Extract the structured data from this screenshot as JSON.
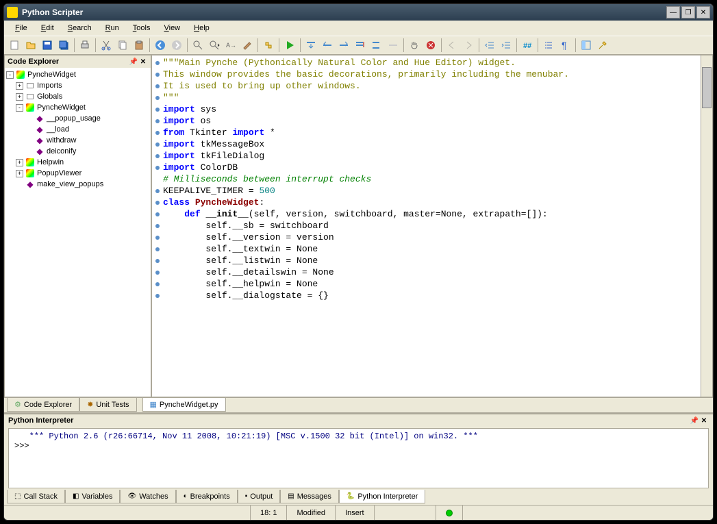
{
  "window": {
    "title": "Python Scripter"
  },
  "menu": [
    "File",
    "Edit",
    "Search",
    "Run",
    "Tools",
    "View",
    "Help"
  ],
  "explorer": {
    "title": "Code Explorer",
    "nodes": [
      {
        "indent": 0,
        "toggle": "-",
        "icon": "module",
        "label": "PyncheWidget"
      },
      {
        "indent": 1,
        "toggle": "+",
        "icon": "folder",
        "label": "Imports"
      },
      {
        "indent": 1,
        "toggle": "+",
        "icon": "folder",
        "label": "Globals"
      },
      {
        "indent": 1,
        "toggle": "-",
        "icon": "module",
        "label": "PyncheWidget"
      },
      {
        "indent": 2,
        "toggle": "",
        "icon": "method",
        "label": "__popup_usage"
      },
      {
        "indent": 2,
        "toggle": "",
        "icon": "method",
        "label": "__load"
      },
      {
        "indent": 2,
        "toggle": "",
        "icon": "method",
        "label": "withdraw"
      },
      {
        "indent": 2,
        "toggle": "",
        "icon": "method",
        "label": "deiconify"
      },
      {
        "indent": 1,
        "toggle": "+",
        "icon": "module",
        "label": "Helpwin"
      },
      {
        "indent": 1,
        "toggle": "+",
        "icon": "module",
        "label": "PopupViewer"
      },
      {
        "indent": 1,
        "toggle": "",
        "icon": "method",
        "label": "make_view_popups"
      }
    ]
  },
  "code": {
    "lines": [
      {
        "m": 1,
        "html": "<span class='str'>\"\"\"Main Pynche (Pythonically Natural Color and Hue Editor) widget.</span>"
      },
      {
        "m": 0,
        "html": ""
      },
      {
        "m": 1,
        "html": "<span class='str'>This window provides the basic decorations, primarily including the menubar.</span>"
      },
      {
        "m": 1,
        "html": "<span class='str'>It is used to bring up other windows.</span>"
      },
      {
        "m": 1,
        "html": "<span class='str'>\"\"\"</span>"
      },
      {
        "m": 0,
        "html": ""
      },
      {
        "m": 1,
        "html": "<span class='kw'>import</span> sys"
      },
      {
        "m": 1,
        "html": "<span class='kw'>import</span> os"
      },
      {
        "m": 1,
        "html": "<span class='kw'>from</span> Tkinter <span class='kw'>import</span> *"
      },
      {
        "m": 1,
        "html": "<span class='kw'>import</span> tkMessageBox"
      },
      {
        "m": 1,
        "html": "<span class='kw'>import</span> tkFileDialog"
      },
      {
        "m": 1,
        "html": "<span class='kw'>import</span> ColorDB"
      },
      {
        "m": 0,
        "html": ""
      },
      {
        "m": 0,
        "html": "<span class='com'># Milliseconds between interrupt checks</span>"
      },
      {
        "m": 1,
        "html": "KEEPALIVE_TIMER = <span class='num'>500</span>"
      },
      {
        "m": 0,
        "html": ""
      },
      {
        "m": 0,
        "html": ""
      },
      {
        "m": 0,
        "html": ""
      },
      {
        "m": 1,
        "html": "<span class='cls'>class</span> <span class='clsname'>PyncheWidget</span>:"
      },
      {
        "m": 1,
        "html": "    <span class='kw'>def</span> <span class='fn'>__init__</span>(self, version, switchboard, master=None, extrapath=[]):"
      },
      {
        "m": 1,
        "html": "        self.__sb = switchboard"
      },
      {
        "m": 1,
        "html": "        self.__version = version"
      },
      {
        "m": 1,
        "html": "        self.__textwin = None"
      },
      {
        "m": 1,
        "html": "        self.__listwin = None"
      },
      {
        "m": 1,
        "html": "        self.__detailswin = None"
      },
      {
        "m": 1,
        "html": "        self.__helpwin = None"
      },
      {
        "m": 1,
        "html": "        self.__dialogstate = {}"
      }
    ]
  },
  "left_tabs": [
    {
      "label": "Code Explorer",
      "icon": "tree"
    },
    {
      "label": "Unit Tests",
      "icon": "bug"
    }
  ],
  "editor_tabs": [
    {
      "label": "PyncheWidget.py",
      "active": true
    }
  ],
  "interpreter": {
    "title": "Python Interpreter",
    "banner": "*** Python 2.6 (r26:66714, Nov 11 2008, 10:21:19) [MSC v.1500 32 bit (Intel)] on win32. ***",
    "prompt": ">>> "
  },
  "bottom_tabs": [
    "Call Stack",
    "Variables",
    "Watches",
    "Breakpoints",
    "Output",
    "Messages",
    "Python Interpreter"
  ],
  "status": {
    "position": "18: 1",
    "modified": "Modified",
    "insert": "Insert"
  }
}
